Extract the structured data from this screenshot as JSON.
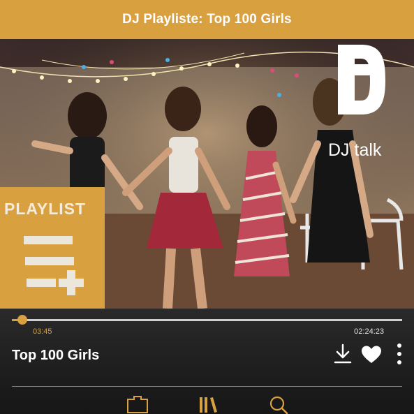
{
  "header": {
    "title": "DJ Playliste: Top 100 Girls"
  },
  "cover": {
    "brand_label": "DJ talk",
    "playlist_label": "PLAYLIST"
  },
  "player": {
    "track_title": "Top 100 Girls",
    "elapsed": "03:45",
    "total": "02:24:23",
    "progress_fraction": 0.026,
    "icons": [
      "download-icon",
      "heart-icon",
      "more-vertical-icon"
    ]
  },
  "nav": {
    "icons": [
      "folder-icon",
      "library-icon",
      "search-icon"
    ]
  },
  "colors": {
    "accent": "#d9a040",
    "background": "#1c1c1c",
    "text": "#ffffff"
  }
}
